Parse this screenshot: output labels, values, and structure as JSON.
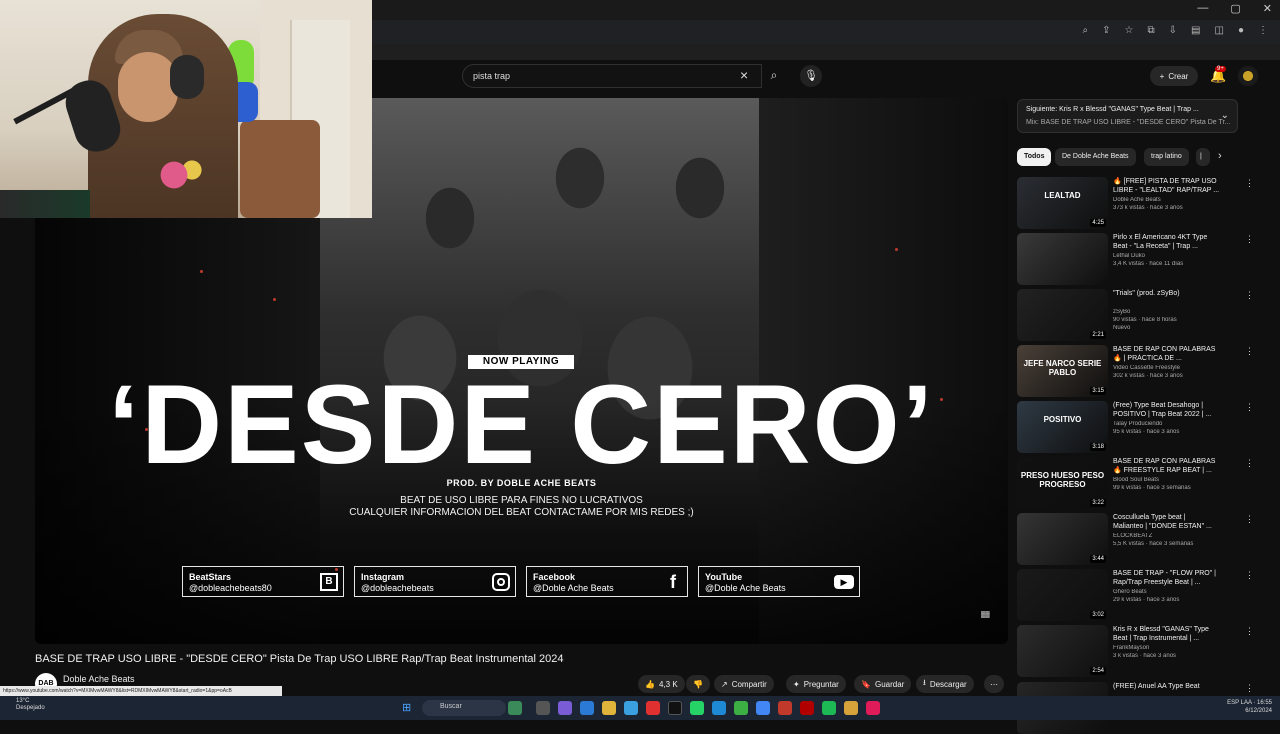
{
  "search": {
    "query": "pista trap"
  },
  "header": {
    "create_label": "Crear",
    "notif_count": "9+"
  },
  "player": {
    "now_playing": "NOW PLAYING",
    "title": "‘DESDE CERO’",
    "prod": "PROD. BY DOBLE ACHE BEATS",
    "license": "BEAT DE USO LIBRE PARA FINES NO LUCRATIVOS",
    "contact": "CUALQUIER INFORMACION DEL BEAT CONTACTAME POR MIS REDES ;)",
    "socials": [
      {
        "name": "BeatStars",
        "handle": "@dobleachebeats80",
        "icon": "beatstars-icon"
      },
      {
        "name": "Instagram",
        "handle": "@dobleachebeats",
        "icon": "instagram-icon"
      },
      {
        "name": "Facebook",
        "handle": "@Doble Ache Beats",
        "icon": "facebook-icon"
      },
      {
        "name": "YouTube",
        "handle": "@Doble Ache Beats",
        "icon": "youtube-icon"
      }
    ]
  },
  "video": {
    "title": "BASE DE TRAP USO LIBRE - \"DESDE CERO\" Pista De Trap USO LIBRE Rap/Trap Beat Instrumental 2024",
    "channel_initials": "DAB",
    "channel": "Doble Ache Beats",
    "likes": "4,3 K",
    "actions": {
      "share": "Compartir",
      "ask": "Preguntar",
      "save": "Guardar",
      "download": "Descargar"
    }
  },
  "sidebar": {
    "up_next_line1": "Siguiente: Kris R x Blessd \"GANAS\" Type Beat | Trap ...",
    "up_next_line2": "Mix: BASE DE TRAP USO LIBRE - \"DESDE CERO\" Pista De Tr...",
    "chips": [
      "Todos",
      "De Doble Ache Beats",
      "trap latino",
      "|"
    ],
    "items": [
      {
        "thumb_text": "LEALTAD",
        "duration": "4:25",
        "title1": "🔥 [FREE] PISTA DE TRAP USO",
        "title2": "LIBRE - \"LEALTAD\" RAP/TRAP ...",
        "meta1": "Doble Ache Beats",
        "meta2": "373 k vistas · hace 3 años",
        "thumb_color": "#2a2e33"
      },
      {
        "thumb_text": "",
        "duration": "",
        "title1": "Pirlo x El Americano 4KT Type",
        "title2": "Beat - \"La Receta\" | Trap ...",
        "meta1": "Lethal Duko",
        "meta2": "3,4 K vistas · hace 11 días",
        "thumb_color": "#3a3a3a"
      },
      {
        "thumb_text": "",
        "duration": "2:21",
        "title1": "\"Trials\" (prod. zSyBo)",
        "title2": "",
        "meta1": "zSyBo",
        "meta2": "90 vistas · hace 8 horas",
        "meta3": "Nuevo",
        "thumb_color": "#222222"
      },
      {
        "thumb_text": "JEFE NARCO SERIE PABLO",
        "duration": "3:15",
        "title1": "BASE DE RAP CON PALABRAS",
        "title2": "🔥 | PRÁCTICA DE ...",
        "meta1": "Video Cassette Freestyle",
        "meta2": "302 k vistas · hace 3 años",
        "thumb_color": "#4a4038"
      },
      {
        "thumb_text": "POSITIVO",
        "duration": "3:18",
        "title1": "(Free) Type Beat Desahogo |",
        "title2": "POSITIVO | Trap Beat 2022 | ...",
        "meta1": "Talay Produciendo",
        "meta2": "95 k vistas · hace 3 años",
        "thumb_color": "#2f3a45"
      },
      {
        "thumb_text": "PRESO HUESO PESO PROGRESO",
        "duration": "3:22",
        "title1": "BASE DE RAP CON PALABRAS",
        "title2": "🔥 FREESTYLE RAP BEAT | ...",
        "meta1": "Blood Soul Beats",
        "meta2": "99 k vistas · hace 3 semanas",
        "thumb_color": "#111111"
      },
      {
        "thumb_text": "",
        "duration": "3:44",
        "title1": "Cosculluela Type beat |",
        "title2": "Malianteo | \"DONDE ESTAN\" ...",
        "meta1": "ELOCKBEATZ",
        "meta2": "5,5 K vistas · hace 3 semanas",
        "thumb_color": "#353535"
      },
      {
        "thumb_text": "",
        "duration": "3:02",
        "title1": "BASE DE TRAP - \"FLOW PRO\" |",
        "title2": "Rap/Trap Freestyle Beat | ...",
        "meta1": "Ghero Beats",
        "meta2": "29 k vistas · hace 3 años",
        "thumb_color": "#1a1a1a"
      },
      {
        "thumb_text": "",
        "duration": "2:54",
        "title1": "Kris R x Blessd \"GANAS\" Type",
        "title2": "Beat | Trap Instrumental | ...",
        "meta1": "FrankMayson",
        "meta2": "3 k vistas · hace 3 años",
        "thumb_color": "#2c2c2c"
      },
      {
        "thumb_text": "",
        "duration": "",
        "title1": "(FREE) Anuel AA Type Beat",
        "title2": "",
        "meta1": "",
        "meta2": "",
        "thumb_color": "#262626"
      }
    ]
  },
  "status_url": "https://www.youtube.com/watch?v=MXIMvwMAWY8&list=RDMXIMvwMAWY8&start_radio=1&pp=oAcB",
  "taskbar": {
    "weather_temp": "13°C",
    "weather_text": "Despejado",
    "search_label": "Buscar",
    "tray_lang": "ESP LAA",
    "time": "16:55",
    "date": "6/12/2024"
  }
}
